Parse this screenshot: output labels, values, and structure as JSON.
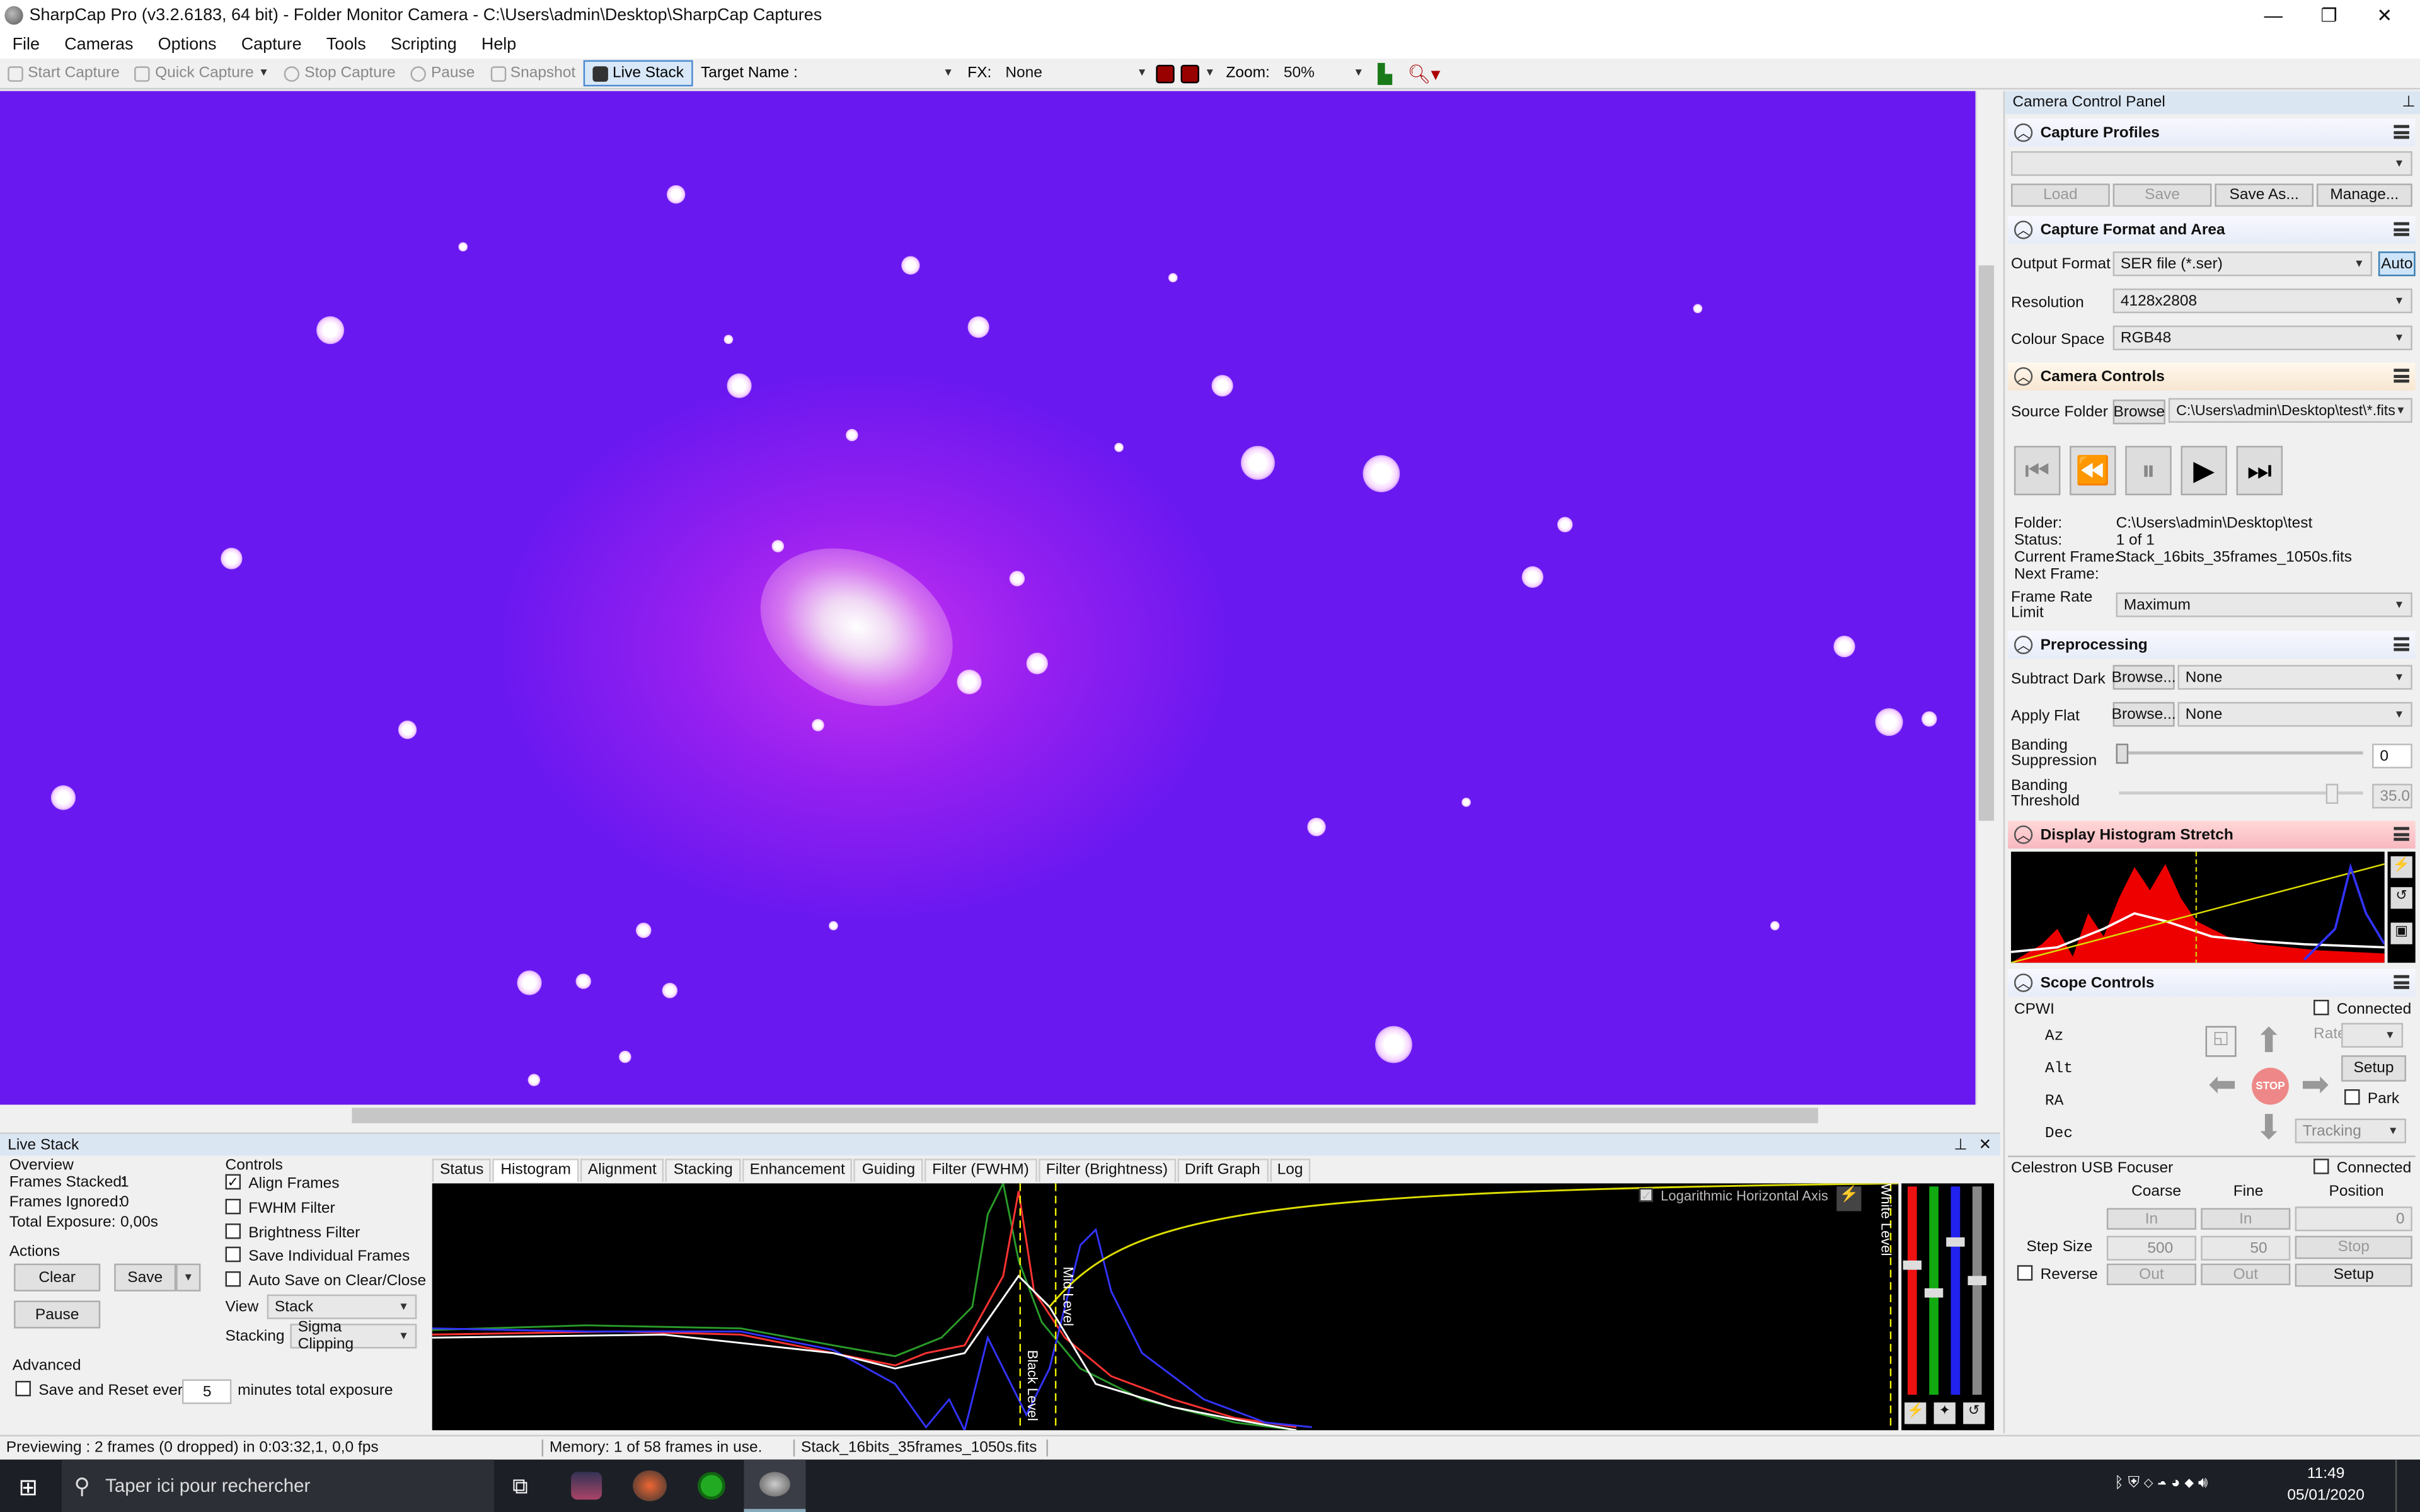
{
  "window": {
    "title": "SharpCap Pro (v3.2.6183, 64 bit) - Folder Monitor Camera - C:\\Users\\admin\\Desktop\\SharpCap Captures"
  },
  "menu": [
    "File",
    "Cameras",
    "Options",
    "Capture",
    "Tools",
    "Scripting",
    "Help"
  ],
  "toolbar": {
    "start_capture": "Start Capture",
    "quick_capture": "Quick Capture",
    "stop_capture": "Stop Capture",
    "pause": "Pause",
    "snapshot": "Snapshot",
    "live_stack": "Live Stack",
    "target_name_label": "Target Name :",
    "fx_label": "FX:",
    "fx_value": "None",
    "zoom_label": "Zoom:",
    "zoom_value": "50%"
  },
  "right_panel": {
    "title": "Camera Control Panel",
    "capture_profiles": {
      "title": "Capture Profiles",
      "load": "Load",
      "save": "Save",
      "save_as": "Save As...",
      "manage": "Manage..."
    },
    "capture_format": {
      "title": "Capture Format and Area",
      "output_format_label": "Output Format",
      "output_format": "SER file (*.ser)",
      "auto": "Auto",
      "resolution_label": "Resolution",
      "resolution": "4128x2808",
      "colour_space_label": "Colour Space",
      "colour_space": "RGB48"
    },
    "camera_controls": {
      "title": "Camera Controls",
      "source_folder_label": "Source Folder",
      "browse": "Browse",
      "source_folder": "C:\\Users\\admin\\Desktop\\test\\*.fits",
      "folder_label": "Folder:",
      "folder": "C:\\Users\\admin\\Desktop\\test",
      "status_label": "Status:",
      "status": "1 of 1",
      "current_frame_label": "Current Frame:",
      "current_frame": "Stack_16bits_35frames_1050s.fits",
      "next_frame_label": "Next Frame:",
      "frame_rate_label_1": "Frame Rate",
      "frame_rate_label_2": "Limit",
      "frame_rate": "Maximum"
    },
    "preprocessing": {
      "title": "Preprocessing",
      "subtract_dark_label": "Subtract Dark",
      "apply_flat_label": "Apply Flat",
      "browse": "Browse...",
      "dark_value": "None",
      "flat_value": "None",
      "banding_supp_1": "Banding",
      "banding_supp_2": "Suppression",
      "banding_supp_value": "0",
      "banding_thr_1": "Banding",
      "banding_thr_2": "Threshold",
      "banding_thr_value": "35.0"
    },
    "display_histogram": {
      "title": "Display Histogram Stretch"
    },
    "scope_controls": {
      "title": "Scope Controls",
      "mount": "CPWI",
      "connected": "Connected",
      "az": "Az",
      "alt": "Alt",
      "ra": "RA",
      "dec": "Dec",
      "rate": "Rate:",
      "setup": "Setup",
      "park": "Park",
      "tracking": "Tracking",
      "stop": "STOP"
    },
    "focuser": {
      "name": "Celestron USB Focuser",
      "connected": "Connected",
      "coarse": "Coarse",
      "fine": "Fine",
      "position": "Position",
      "in": "In",
      "out": "Out",
      "position_value": "0",
      "step_size_label": "Step Size",
      "coarse_step": "500",
      "fine_step": "50",
      "stop": "Stop",
      "reverse": "Reverse",
      "setup": "Setup"
    }
  },
  "live_stack": {
    "title": "Live Stack",
    "overview": "Overview",
    "frames_stacked_label": "Frames Stacked:",
    "frames_stacked": "1",
    "frames_ignored_label": "Frames Ignored:",
    "frames_ignored": "0",
    "total_exposure_label": "Total Exposure:",
    "total_exposure": "0,00s",
    "actions": "Actions",
    "clear": "Clear",
    "save": "Save",
    "pause": "Pause",
    "advanced": "Advanced",
    "save_reset": "Save and Reset every",
    "minutes": "5",
    "minutes_label": "minutes total exposure",
    "controls": "Controls",
    "align_frames": "Align Frames",
    "fwhm_filter": "FWHM Filter",
    "brightness_filter": "Brightness Filter",
    "save_individual": "Save Individual Frames",
    "auto_save": "Auto Save on Clear/Close",
    "view_label": "View",
    "view_value": "Stack",
    "stacking_label": "Stacking",
    "stacking_value": "Sigma Clipping",
    "tabs": [
      "Status",
      "Histogram",
      "Alignment",
      "Stacking",
      "Enhancement",
      "Guiding",
      "Filter (FWHM)",
      "Filter (Brightness)",
      "Drift Graph",
      "Log"
    ],
    "log_axis": "Logarithmic Horizontal Axis",
    "black_level": "Black Level",
    "mid_level": "Mid Level",
    "white_level": "White Level"
  },
  "status_bar": {
    "preview": "Previewing : 2 frames (0 dropped) in 0:03:32,1, 0,0 fps",
    "memory": "Memory: 1 of 58 frames in use.",
    "file": "Stack_16bits_35frames_1050s.fits"
  },
  "taskbar": {
    "search": "Taper ici pour rechercher",
    "time": "11:49",
    "date": "05/01/2020"
  }
}
